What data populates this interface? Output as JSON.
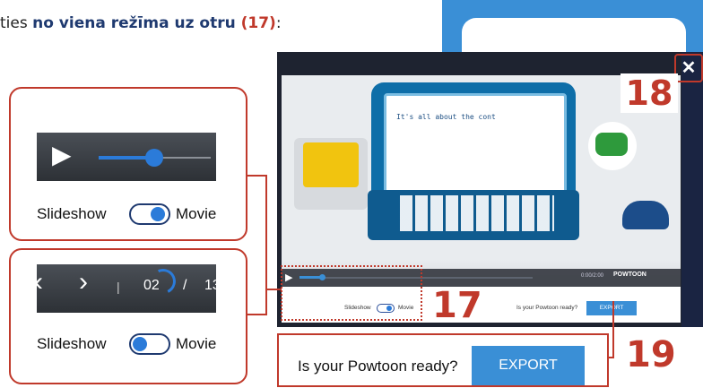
{
  "heading": {
    "prefix": "ties ",
    "bold_text": "no viena režīma uz otru ",
    "ref": "(17)",
    "suffix": ":"
  },
  "video": {
    "screen_text": "It's all about the cont"
  },
  "controls": {
    "time": "0:00/2:00",
    "brand": "POWTOON"
  },
  "footer": {
    "slideshow_label": "Slideshow",
    "movie_label": "Movie",
    "ready_text": "Is your Powtoon ready?",
    "export_label": "EXPORT"
  },
  "close_label": "✕",
  "markers": {
    "n17": "17",
    "n18": "18",
    "n19": "19"
  },
  "callout_movie": {
    "slideshow_label": "Slideshow",
    "movie_label": "Movie",
    "progress_fraction": 0.45,
    "mode": "movie"
  },
  "callout_slideshow": {
    "separator": "|",
    "current_page": "02",
    "slash": "/",
    "total_pages": "13",
    "slideshow_label": "Slideshow",
    "movie_label": "Movie",
    "mode": "slideshow"
  },
  "export_panel": {
    "ready_text": "Is your Powtoon ready?",
    "export_label": "EXPORT"
  },
  "colors": {
    "accent": "#3a8fd6",
    "highlight": "#c0392b",
    "dark": "#1e2330"
  }
}
